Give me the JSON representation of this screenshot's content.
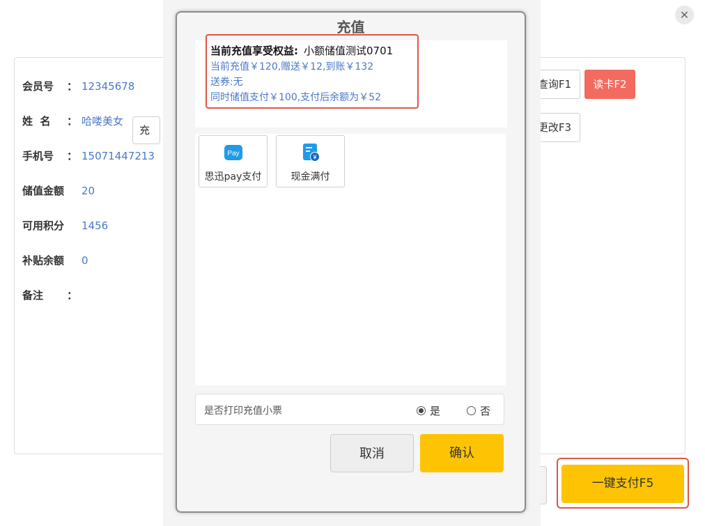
{
  "background": {
    "close_symbol": "✕",
    "member": {
      "rows": [
        {
          "label": "会员号",
          "colon": "：",
          "value": "12345678"
        },
        {
          "label": "姓  名",
          "colon": "：",
          "value": "哈喽美女"
        },
        {
          "label": "手机号",
          "colon": "：",
          "value": "15071447213"
        },
        {
          "label": "储值金额",
          "colon": "",
          "value": "20"
        },
        {
          "label": "可用积分",
          "colon": "",
          "value": "1456"
        },
        {
          "label": "补贴余额",
          "colon": "",
          "value": "0"
        },
        {
          "label": "备注",
          "colon": "：",
          "value": ""
        }
      ],
      "recharge_input_text": "充"
    },
    "buttons": {
      "query": "查询F1",
      "read_card": "读卡F2",
      "change": "更改F3",
      "pay_all": "一键支付F5"
    }
  },
  "modal": {
    "title": "充值",
    "benefit": {
      "heading": "当前充值享受权益:",
      "plan_name": "小额储值测试0701",
      "line1": "当前充值￥120,赠送￥12,到账￥132",
      "line2": "送券:无",
      "line3": "同时储值支付￥100,支付后余额为￥52"
    },
    "pay_methods": [
      {
        "label": "思迅pay支付",
        "icon": "pay-icon",
        "icon_text": "Pay"
      },
      {
        "label": "现金满付",
        "icon": "cash-receipt-icon",
        "icon_text": "¥"
      }
    ],
    "print_receipt": {
      "label": "是否打印充值小票",
      "yes": "是",
      "no": "否",
      "selected": "yes"
    },
    "buttons": {
      "cancel": "取消",
      "confirm": "确认"
    }
  },
  "colors": {
    "accent_yellow": "#fec404",
    "read_card_red": "#f36b5f",
    "highlight_red": "#e05545",
    "value_blue": "#4a78c8",
    "icon_blue": "#1e9be9"
  }
}
